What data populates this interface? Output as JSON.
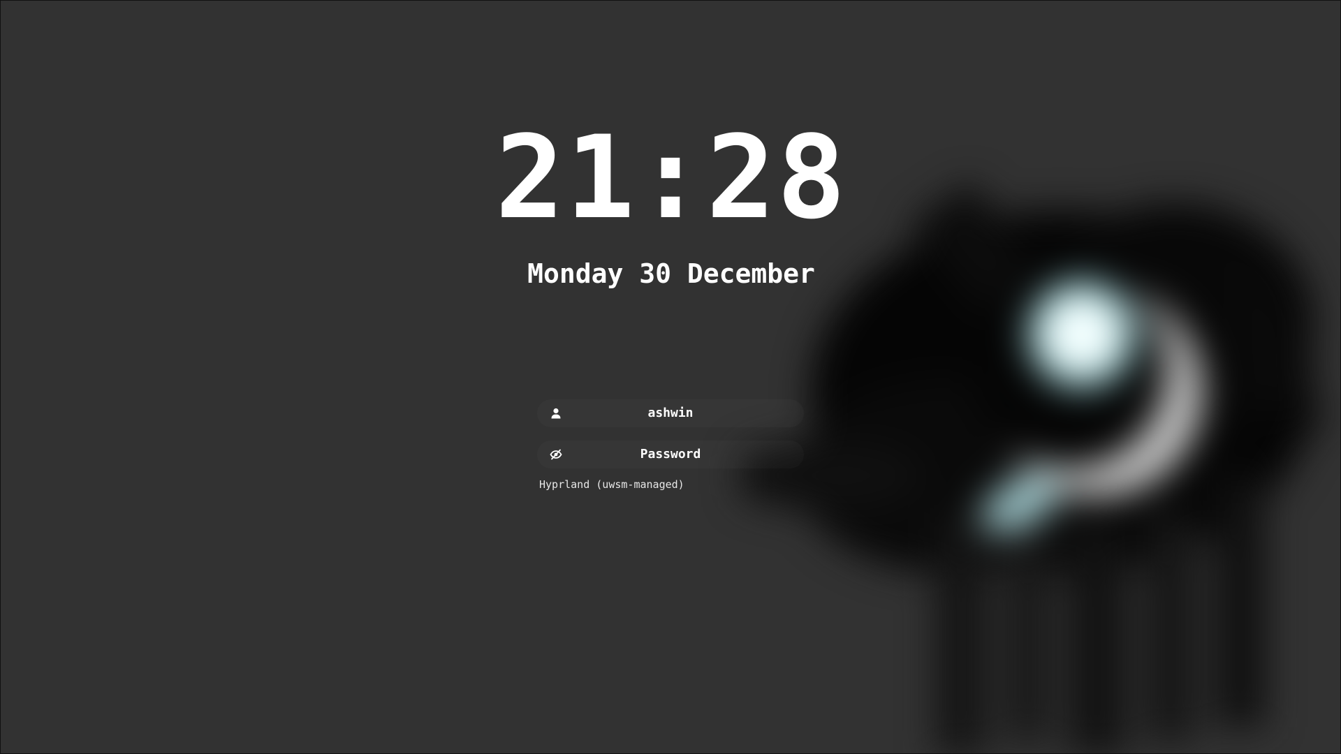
{
  "lockscreen": {
    "time": "21:28",
    "date": "Monday 30 December",
    "username": "ashwin",
    "password_placeholder": "Password",
    "session": "Hyprland (uwsm-managed)"
  },
  "icons": {
    "user": "user-icon",
    "password": "eye-off-icon"
  },
  "colors": {
    "background": "#323232",
    "text": "#ffffff",
    "wallpaper_glow": "#d9f6f7"
  }
}
